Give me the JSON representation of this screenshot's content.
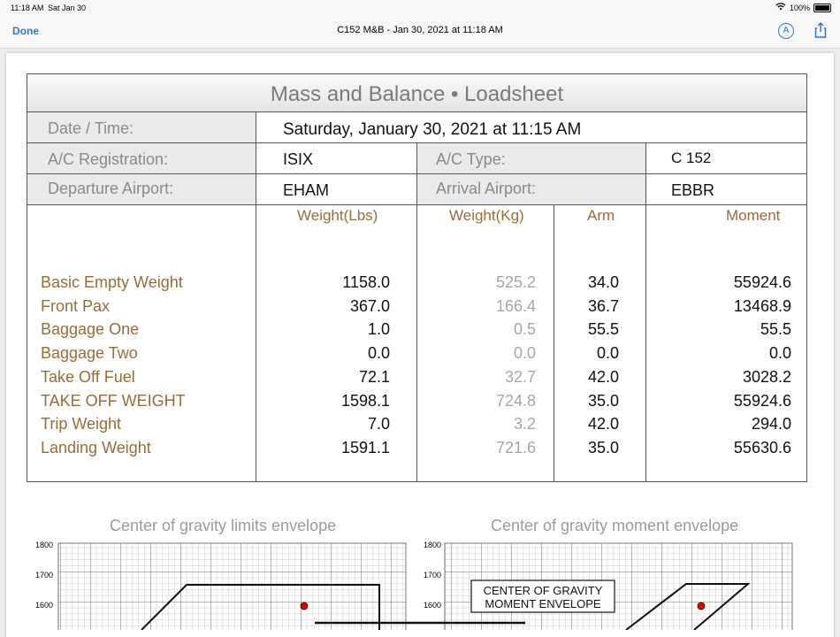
{
  "status": {
    "time": "11:18 AM",
    "date": "Sat Jan 30",
    "battery": "100%"
  },
  "nav": {
    "done": "Done",
    "title": "C152 M&B - Jan 30, 2021 at 11:18 AM",
    "markup_icon": "A"
  },
  "sheet": {
    "title": "Mass and Balance • Loadsheet",
    "date_label": "Date / Time:",
    "date_value": "Saturday, January 30, 2021 at 11:15 AM",
    "reg_label": "A/C Registration:",
    "reg_value": "ISIX",
    "type_label": "A/C Type:",
    "type_value": "C 152",
    "dep_label": "Departure Airport:",
    "dep_value": "EHAM",
    "arr_label": "Arrival Airport:",
    "arr_value": "EBBR"
  },
  "table": {
    "headers": [
      "Weight(Lbs)",
      "Weight(Kg)",
      "Arm",
      "Moment"
    ],
    "rows": [
      {
        "label": "Basic Empty Weight",
        "lbs": "1158.0",
        "kg": "525.2",
        "arm": "34.0",
        "moment": "55924.6"
      },
      {
        "label": "Front Pax",
        "lbs": "367.0",
        "kg": "166.4",
        "arm": "36.7",
        "moment": "13468.9"
      },
      {
        "label": "Baggage One",
        "lbs": "1.0",
        "kg": "0.5",
        "arm": "55.5",
        "moment": "55.5"
      },
      {
        "label": "Baggage Two",
        "lbs": "0.0",
        "kg": "0.0",
        "arm": "0.0",
        "moment": "0.0"
      },
      {
        "label": "Take Off Fuel",
        "lbs": "72.1",
        "kg": "32.7",
        "arm": "42.0",
        "moment": "3028.2"
      },
      {
        "label": "TAKE OFF WEIGHT",
        "lbs": "1598.1",
        "kg": "724.8",
        "arm": "35.0",
        "moment": "55924.6"
      },
      {
        "label": "Trip Weight",
        "lbs": "7.0",
        "kg": "3.2",
        "arm": "42.0",
        "moment": "294.0"
      },
      {
        "label": "Landing Weight",
        "lbs": "1591.1",
        "kg": "721.6",
        "arm": "35.0",
        "moment": "55630.6"
      }
    ]
  },
  "envelopes": {
    "left_title": "Center of gravity limits envelope",
    "right_title": "Center of gravity moment envelope",
    "y_ticks": [
      "1800",
      "1700",
      "1600"
    ],
    "box_line1": "CENTER OF GRAVITY",
    "box_line2": "MOMENT ENVELOPE"
  }
}
